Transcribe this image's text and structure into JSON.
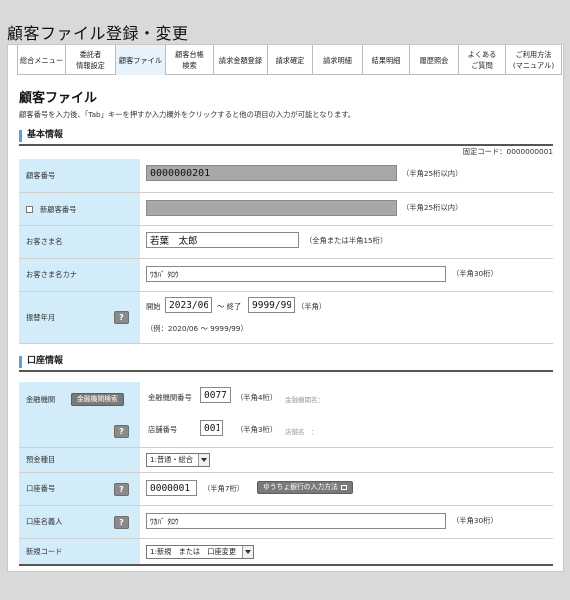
{
  "page_title": "顧客ファイル登録・変更",
  "nav": [
    {
      "label": "総合メニュー",
      "width": 48
    },
    {
      "label": "委託者\n情報設定",
      "width": 50
    },
    {
      "label": "顧客ファイル",
      "width": 50,
      "active": true
    },
    {
      "label": "顧客台帳\n検索",
      "width": 48
    },
    {
      "label": "請求金額登録",
      "width": 54
    },
    {
      "label": "請求確定",
      "width": 45
    },
    {
      "label": "請求明細",
      "width": 50
    },
    {
      "label": "結果明細",
      "width": 47
    },
    {
      "label": "履歴照会",
      "width": 49
    },
    {
      "label": "よくある\nご質問",
      "width": 47
    },
    {
      "label": "ご利用方法\n(マニュアル)",
      "width": 56
    }
  ],
  "heading": "顧客ファイル",
  "description": "顧客番号を入力後、「Tab」キーを押すか入力欄外をクリックすると他の項目の入力が可能となります。",
  "basic": {
    "title": "基本情報",
    "fixed_code": "固定コード：0000000001",
    "customer_number": {
      "label": "顧客番号",
      "value": "0000000201",
      "note": "（半角25桁以内）"
    },
    "new_customer_number": {
      "label": "新顧客番号",
      "value": "",
      "note": "（半角25桁以内）"
    },
    "customer_name": {
      "label": "お客さま名",
      "value": "若葉　太郎",
      "note": "（全角または半角15桁）"
    },
    "customer_kana": {
      "label": "お客さま名カナ",
      "value": "ﾜｶﾊﾞ ﾀﾛｳ",
      "note": "（半角30桁）"
    },
    "transfer": {
      "label": "振替年月",
      "start_label": "開始",
      "start_value": "2023/06",
      "end_label": "～ 終了",
      "end_value": "9999/99",
      "note": "（半角）",
      "example": "（例：2020/06 ～ 9999/99）"
    }
  },
  "account": {
    "title": "口座情報",
    "bank": {
      "label": "金融機関",
      "search_button": "金融機関検索",
      "bank_code_label": "金融機関番号",
      "bank_code_value": "0077",
      "bank_code_note": "（半角4桁）",
      "bank_name_label": "金融機関名：",
      "branch_code_label": "店舗番号",
      "branch_code_value": "001",
      "branch_code_note": "（半角3桁）",
      "branch_name_label": "店舗名　："
    },
    "deposit_type": {
      "label": "預金種目",
      "value": "1:普通・総合"
    },
    "account_number": {
      "label": "口座番号",
      "value": "0000001",
      "note": "（半角7桁）",
      "yucho_button": "ゆうちょ銀行の入力方法"
    },
    "account_holder": {
      "label": "口座名義人",
      "value": "ﾜｶﾊﾞ ﾀﾛｳ",
      "note": "（半角30桁）"
    },
    "new_code": {
      "label": "新規コード",
      "value": "1:新規　または　口座変更"
    }
  },
  "icons": {
    "help": "?"
  }
}
